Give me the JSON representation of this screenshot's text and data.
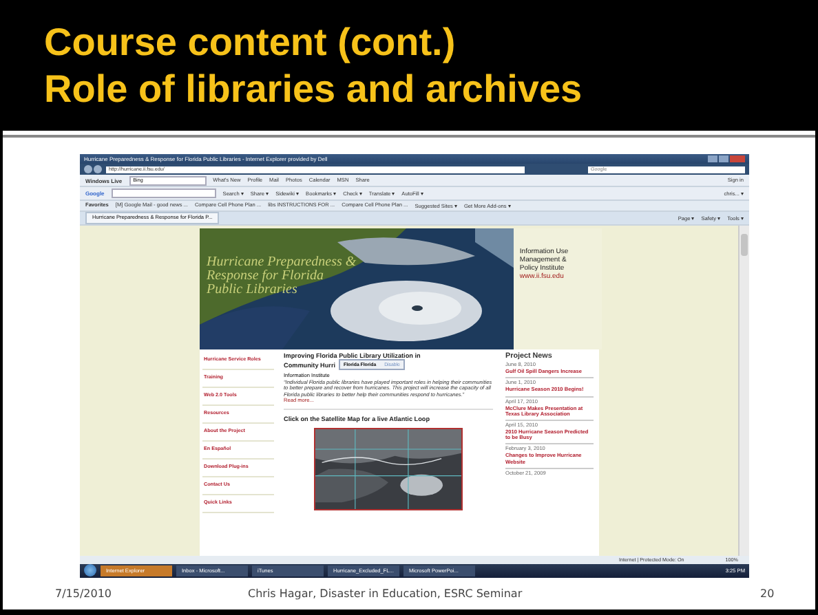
{
  "slide": {
    "title_lines": [
      "Course content (cont.)",
      "Role of libraries and archives"
    ],
    "footer": {
      "date": "7/15/2010",
      "author": "Chris Hagar, Disaster in Education, ESRC Seminar",
      "page": "20"
    }
  },
  "browser": {
    "title": "Hurricane Preparedness & Response for Florida Public Libraries - Internet Explorer provided by Dell",
    "address": "http://hurricane.ii.fsu.edu/",
    "search_placeholder": "Google",
    "live_toolbar": {
      "brand": "Windows Live",
      "search": "Bing",
      "links": [
        "What's New",
        "Profile",
        "Mail",
        "Photos",
        "Calendar",
        "MSN",
        "Share"
      ],
      "signin": "Sign in"
    },
    "google_toolbar": {
      "brand": "Google",
      "items": [
        "Search ▾",
        "Share ▾",
        "Sidewiki ▾",
        "Bookmarks ▾",
        "Check ▾",
        "Translate ▾",
        "AutoFill ▾"
      ],
      "account": "chris... ▾"
    },
    "favorites": {
      "label": "Favorites",
      "items": [
        "[M] Google Mail - good news ...",
        "Compare Cell Phone Plan ...",
        "libs INSTRUCTIONS FOR ...",
        "Compare Cell Phone Plan ...",
        "Suggested Sites ▾",
        "Get More Add-ons ▾"
      ]
    },
    "tab": {
      "label": "Hurricane Preparedness & Response for Florida P..."
    },
    "commands": [
      "Page ▾",
      "Safety ▾",
      "Tools ▾"
    ]
  },
  "page": {
    "banner": {
      "title_lines": [
        "Hurricane Preparedness &",
        "Response for Florida",
        "Public Libraries"
      ],
      "institute_lines": [
        "Information Use",
        "Management &",
        "Policy Institute"
      ],
      "url": "www.ii.fsu.edu"
    },
    "nav": [
      "Hurricane Service Roles",
      "Training",
      "Web 2.0 Tools",
      "Resources",
      "About the Project",
      "En Español",
      "Download Plug-ins",
      "Contact Us",
      "Quick Links"
    ],
    "article": {
      "heading_lines": [
        "Improving Florida Public Library Utilization in",
        "Community Hurri"
      ],
      "popup": {
        "label": "Florida Florida",
        "action": "Disable"
      },
      "intro": "Information Institute",
      "body": "“Individual Florida public libraries have played important roles in helping their communities to better prepare and recover from hurricanes. This project will increase the capacity of all Florida public libraries to better help their communities respond to hurricanes.”",
      "read_more": "Read more...",
      "map_heading": "Click on the Satellite Map for a live Atlantic Loop"
    },
    "news": {
      "title": "Project News",
      "items": [
        {
          "date": "June 8, 2010",
          "headline": "Gulf Oil Spill Dangers Increase"
        },
        {
          "date": "June 1, 2010",
          "headline": "Hurricane Season 2010 Begins!"
        },
        {
          "date": "April 17, 2010",
          "headline": "McClure Makes Presentation at Texas Library Association"
        },
        {
          "date": "April 15, 2010",
          "headline": "2010 Hurricane Season Predicted to be Busy"
        },
        {
          "date": "February 3, 2010",
          "headline": "Changes to Improve Hurricane Website"
        }
      ],
      "last_date": "October 21, 2009"
    }
  },
  "status": {
    "zone": "Internet | Protected Mode: On",
    "zoom": "100%"
  },
  "taskbar": {
    "items": [
      {
        "label": "Internet Explorer",
        "selected": true
      },
      {
        "label": "Inbox - Microsoft...",
        "selected": false
      },
      {
        "label": "iTunes",
        "selected": false
      },
      {
        "label": "Hurricane_Excluded_FL...",
        "selected": false
      },
      {
        "label": "Microsoft PowerPoi...",
        "selected": false
      }
    ],
    "clock": "3:25 PM"
  }
}
